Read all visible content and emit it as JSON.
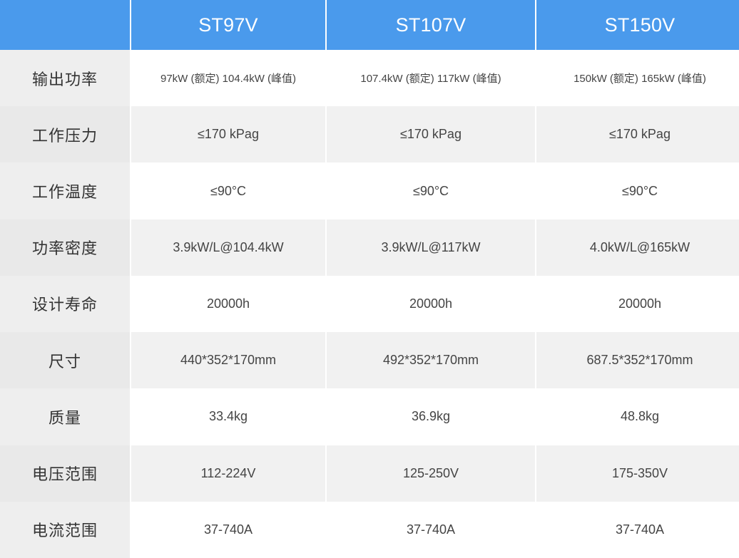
{
  "header": {
    "models": [
      "ST97V",
      "ST107V",
      "ST150V"
    ]
  },
  "rows": [
    {
      "label": "输出功率",
      "values": [
        "97kW (额定) 104.4kW (峰值)",
        "107.4kW (额定) 117kW (峰值)",
        "150kW (额定) 165kW (峰值)"
      ]
    },
    {
      "label": "工作压力",
      "values": [
        "≤170 kPag",
        "≤170 kPag",
        "≤170 kPag"
      ]
    },
    {
      "label": "工作温度",
      "values": [
        "≤90°C",
        "≤90°C",
        "≤90°C"
      ]
    },
    {
      "label": "功率密度",
      "values": [
        "3.9kW/L@104.4kW",
        "3.9kW/L@117kW",
        "4.0kW/L@165kW"
      ]
    },
    {
      "label": "设计寿命",
      "values": [
        "20000h",
        "20000h",
        "20000h"
      ]
    },
    {
      "label": "尺寸",
      "values": [
        "440*352*170mm",
        "492*352*170mm",
        "687.5*352*170mm"
      ]
    },
    {
      "label": "质量",
      "values": [
        "33.4kg",
        "36.9kg",
        "48.8kg"
      ]
    },
    {
      "label": "电压范围",
      "values": [
        "112-224V",
        "125-250V",
        "175-350V"
      ]
    },
    {
      "label": "电流范围",
      "values": [
        "37-740A",
        "37-740A",
        "37-740A"
      ]
    }
  ],
  "colors": {
    "header_bg": "#4a9aec",
    "header_text": "#ffffff",
    "label_bg": "#eeeeee",
    "row_alt_bg": "#f1f1f1"
  }
}
